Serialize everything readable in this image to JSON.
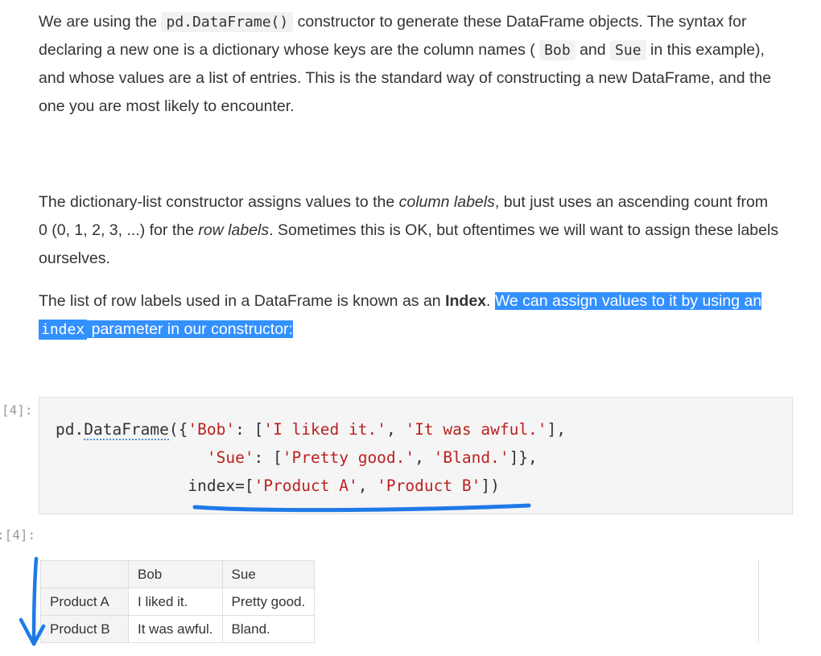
{
  "intro": {
    "t1": "We are using the ",
    "code1": "pd.DataFrame()",
    "t2": " constructor to generate these DataFrame objects. The syntax for declaring a new one is a dictionary whose keys are the column names ( ",
    "code2": "Bob",
    "t3": " and ",
    "code3": "Sue",
    "t4": " in this example), and whose values are a list of entries. This is the standard way of constructing a new DataFrame, and the one you are most likely to encounter."
  },
  "para2": {
    "t1": "The dictionary-list constructor assigns values to the ",
    "em1": "column labels",
    "t2": ", but just uses an ascending count from 0 (0, 1, 2, 3, ...) for the ",
    "em2": "row labels",
    "t3": ". Sometimes this is OK, but oftentimes we will want to assign these labels ourselves."
  },
  "para3": {
    "t1": "The list of row labels used in a DataFrame is known as an ",
    "strong": "Index",
    "t2": ". ",
    "hl1": "We can assign values to it by using an ",
    "code": "index",
    "hl2": " parameter in our constructor:"
  },
  "cell_in": {
    "prompt": "[4]:",
    "line1_a": "pd.",
    "line1_fn": "DataFrame",
    "line1_b": "({",
    "line1_s1": "'Bob'",
    "line1_c": ": [",
    "line1_s2": "'I liked it.'",
    "line1_d": ", ",
    "line1_s3": "'It was awful.'",
    "line1_e": "],",
    "line2_pad": "                ",
    "line2_s1": "'Sue'",
    "line2_c": ": [",
    "line2_s2": "'Pretty good.'",
    "line2_d": ", ",
    "line2_s3": "'Bland.'",
    "line2_e": "]},",
    "line3_pad": "              ",
    "line3_a": "index=[",
    "line3_s1": "'Product A'",
    "line3_d": ", ",
    "line3_s2": "'Product B'",
    "line3_e": "])"
  },
  "cell_out": {
    "prompt": ":[4]:",
    "columns": [
      "Bob",
      "Sue"
    ],
    "rows": [
      {
        "index": "Product A",
        "cells": [
          "I liked it.",
          "Pretty good."
        ]
      },
      {
        "index": "Product B",
        "cells": [
          "It was awful.",
          "Bland."
        ]
      }
    ]
  },
  "colors": {
    "highlight": "#3390ff",
    "annotation_ink": "#1e7ae6",
    "string": "#ba2121"
  }
}
